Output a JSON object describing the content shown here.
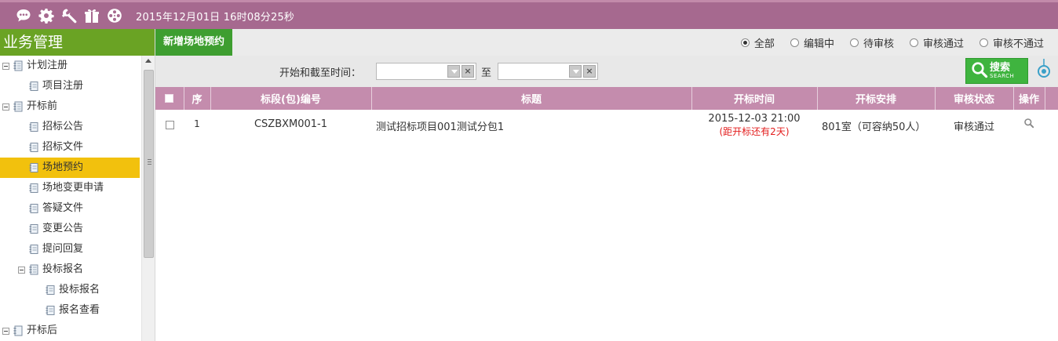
{
  "topbar": {
    "datetime": "2015年12月01日 16时08分25秒",
    "icons": [
      "chat-icon",
      "gear-icon",
      "wrench-icon",
      "gift-icon",
      "film-reel-icon"
    ]
  },
  "sidebar": {
    "title": "业务管理",
    "items": [
      {
        "label": "计划注册",
        "level": 0,
        "group": true
      },
      {
        "label": "项目注册",
        "level": 1
      },
      {
        "label": "开标前",
        "level": 0,
        "group": true
      },
      {
        "label": "招标公告",
        "level": 1
      },
      {
        "label": "招标文件",
        "level": 1
      },
      {
        "label": "场地预约",
        "level": 1,
        "active": true
      },
      {
        "label": "场地变更申请",
        "level": 1
      },
      {
        "label": "答疑文件",
        "level": 1
      },
      {
        "label": "变更公告",
        "level": 1
      },
      {
        "label": "提问回复",
        "level": 1
      },
      {
        "label": "投标报名",
        "level": 1,
        "group": true
      },
      {
        "label": "投标报名",
        "level": 2
      },
      {
        "label": "报名查看",
        "level": 2
      },
      {
        "label": "开标后",
        "level": 0,
        "group": true
      }
    ]
  },
  "main": {
    "tab_label": "新增场地预约",
    "filters": [
      {
        "label": "全部",
        "checked": true
      },
      {
        "label": "编辑中",
        "checked": false
      },
      {
        "label": "待审核",
        "checked": false
      },
      {
        "label": "审核通过",
        "checked": false
      },
      {
        "label": "审核不通过",
        "checked": false
      }
    ],
    "search": {
      "time_label": "开始和截至时间：",
      "to_label": "至",
      "start_value": "",
      "end_value": "",
      "button_text": "搜索",
      "button_subtext": "SEARCH"
    },
    "table": {
      "headers": [
        "序",
        "标段(包)编号",
        "标题",
        "开标时间",
        "开标安排",
        "审核状态",
        "操作"
      ],
      "rows": [
        {
          "index": "1",
          "code": "CSZBXM001-1",
          "title": "测试招标项目001测试分包1",
          "open_time": "2015-12-03 21:00",
          "countdown": "(距开标还有2天)",
          "arrangement": "801室（可容纳50人）",
          "status": "审核通过"
        }
      ]
    }
  },
  "colors": {
    "topbar": "#a6698f",
    "sidebar_title": "#6aa324",
    "active_item": "#f2c10d",
    "table_header": "#c48cad",
    "tab_active": "#3e9e30",
    "search_button": "#3fb43f",
    "countdown": "#e31c1c"
  }
}
